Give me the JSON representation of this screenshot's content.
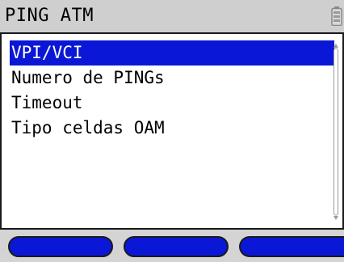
{
  "titlebar": {
    "title": "PING ATM",
    "battery_icon": "battery-icon"
  },
  "menu": {
    "items": [
      {
        "label": "VPI/VCI",
        "selected": true
      },
      {
        "label": "Numero de PINGs",
        "selected": false
      },
      {
        "label": "Timeout",
        "selected": false
      },
      {
        "label": "Tipo celdas OAM",
        "selected": false
      }
    ],
    "scrollbar_icon": "scrollbar-icon"
  },
  "softkeys": {
    "count": 3
  },
  "colors": {
    "accent": "#0b17d6",
    "titlebar_bg": "#cfcfcf",
    "softkey_bar_bg": "#d4d4d4"
  }
}
